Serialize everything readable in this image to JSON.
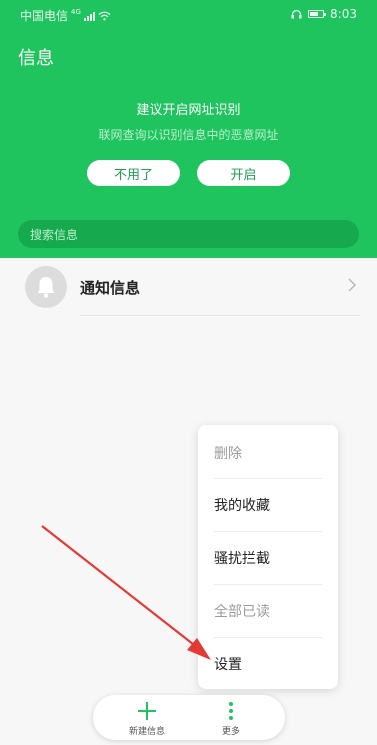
{
  "status_bar": {
    "carrier": "中国电信",
    "network": "4G",
    "time": "8:03"
  },
  "header": {
    "title": "信息"
  },
  "suggestion": {
    "title": "建议开启网址识别",
    "description": "联网查询以识别信息中的恶意网址",
    "dismiss_label": "不用了",
    "enable_label": "开启"
  },
  "search": {
    "placeholder": "搜索信息"
  },
  "conversations": [
    {
      "label": "通知信息",
      "icon": "bell-icon"
    }
  ],
  "menu": {
    "items": [
      {
        "label": "删除",
        "enabled": false
      },
      {
        "label": "我的收藏",
        "enabled": true
      },
      {
        "label": "骚扰拦截",
        "enabled": true
      },
      {
        "label": "全部已读",
        "enabled": false
      },
      {
        "label": "设置",
        "enabled": true
      }
    ]
  },
  "bottom_bar": {
    "new_label": "新建信息",
    "more_label": "更多"
  },
  "colors": {
    "accent_green": "#1fc45e",
    "annotation_arrow": "#e53935"
  }
}
